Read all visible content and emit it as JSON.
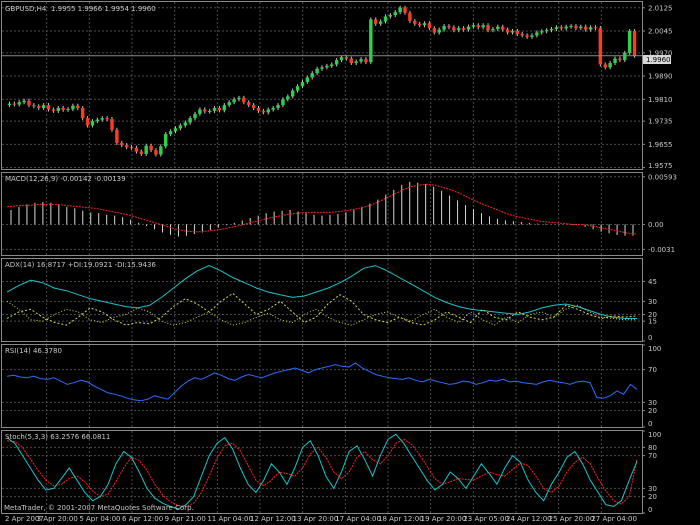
{
  "header": {
    "symbol": "GBPUSD,H4",
    "ohlc": "1.9955 1.9966 1.9954 1.9960",
    "current_price": "1.9960"
  },
  "colors": {
    "background": "#000000",
    "grid": "#4a4a4a",
    "axis_text": "#c8c8c8",
    "bull_candle": "#2fd14a",
    "bear_candle": "#ff3a28",
    "candle_wick": "#c8c8c8",
    "macd_hist": "#d8d8d8",
    "macd_signal": "#ff2020",
    "adx": "#19c3c8",
    "plus_di": "#d9d94a",
    "minus_di": "#d9d94a",
    "rsi": "#2a6dff",
    "stoch_main": "#19c3c8",
    "stoch_signal": "#ff2020"
  },
  "footer": {
    "copyright": "MetaTrader, © 2001-2007 MetaQuotes Software Corp."
  },
  "chart_data": [
    {
      "type": "candlestick",
      "title": "GBPUSD,H4",
      "yticks": [
        "2.0125",
        "2.0045",
        "1.9970",
        "1.9890",
        "1.9810",
        "1.9735",
        "1.9655",
        "1.9575"
      ],
      "ylim": [
        1.957,
        2.0145
      ],
      "close": [
        1.9795,
        1.9792,
        1.98,
        1.9805,
        1.979,
        1.9786,
        1.978,
        1.979,
        1.9775,
        1.977,
        1.978,
        1.9774,
        1.9776,
        1.9788,
        1.978,
        1.9745,
        1.972,
        1.9735,
        1.974,
        1.9745,
        1.9742,
        1.9705,
        1.966,
        1.9652,
        1.9645,
        1.9643,
        1.963,
        1.9622,
        1.965,
        1.9635,
        1.962,
        1.9648,
        1.969,
        1.97,
        1.971,
        1.972,
        1.973,
        1.9745,
        1.976,
        1.9775,
        1.9768,
        1.977,
        1.978,
        1.9772,
        1.979,
        1.98,
        1.981,
        1.9815,
        1.98,
        1.979,
        1.978,
        1.977,
        1.9765,
        1.9775,
        1.978,
        1.979,
        1.981,
        1.982,
        1.984,
        1.9855,
        1.987,
        1.9885,
        1.99,
        1.9915,
        1.992,
        1.9925,
        1.993,
        1.9945,
        1.9955,
        1.995,
        1.9935,
        1.994,
        1.9948,
        1.9938,
        2.0085,
        2.007,
        2.0078,
        2.0095,
        2.01,
        2.011,
        2.0125,
        2.0108,
        2.008,
        2.007,
        2.0065,
        2.0072,
        2.0055,
        2.004,
        2.005,
        2.0062,
        2.0058,
        2.0048,
        2.0055,
        2.005,
        2.006,
        2.0065,
        2.0058,
        2.0065,
        2.0048,
        2.0052,
        2.006,
        2.005,
        2.004,
        2.0045,
        2.0035,
        2.003,
        2.0025,
        2.003,
        2.004,
        2.0044,
        2.0048,
        2.0052,
        2.0058,
        2.0054,
        2.006,
        2.0062,
        2.0055,
        2.006,
        2.005,
        2.0058,
        2.0055,
        1.993,
        1.992,
        1.9935,
        1.995,
        1.9945,
        1.997,
        2.0045,
        1.996
      ],
      "x_labels": [
        "2 Apr 2007",
        "3 Apr 20:00",
        "5 Apr 04:00",
        "6 Apr 12:00",
        "9 Apr 21:00",
        "11 Apr 04:00",
        "12 Apr 12:00",
        "13 Apr 20:00",
        "17 Apr 04:00",
        "18 Apr 12:00",
        "19 Apr 20:00",
        "23 Apr 05:00",
        "24 Apr 12:00",
        "25 Apr 20:00",
        "27 Apr 04:00"
      ]
    },
    {
      "type": "bar",
      "title": "MACD(12,26,9) -0.00142 -0.00139",
      "yticks": [
        "0.00593",
        "0.00",
        "-0.0031"
      ],
      "ylim": [
        -0.0038,
        0.0064
      ],
      "series": [
        {
          "name": "MACD",
          "values": [
            0.0018,
            0.0022,
            0.0025,
            0.0027,
            0.0028,
            0.0027,
            0.0025,
            0.0022,
            0.002,
            0.0017,
            0.0015,
            0.0014,
            0.0012,
            0.0011,
            0.0009,
            0.0006,
            0.0002,
            -0.0002,
            -0.0006,
            -0.001,
            -0.0013,
            -0.0015,
            -0.0014,
            -0.0012,
            -0.001,
            -0.0007,
            -0.0004,
            -0.0001,
            0.0002,
            0.0005,
            0.0008,
            0.0011,
            0.0014,
            0.0016,
            0.0017,
            0.0018,
            0.0016,
            0.0014,
            0.0012,
            0.0011,
            0.0012,
            0.0013,
            0.0015,
            0.0018,
            0.0022,
            0.0026,
            0.0031,
            0.0037,
            0.0043,
            0.0049,
            0.0053,
            0.0052,
            0.005,
            0.0047,
            0.0042,
            0.0036,
            0.003,
            0.0024,
            0.0019,
            0.0014,
            0.001,
            0.0007,
            0.0005,
            0.0004,
            0.0003,
            0.0002,
            0.0001,
            0.0001,
            0.0,
            0.0,
            0.0001,
            0.0,
            -0.0003,
            -0.0006,
            -0.0009,
            -0.0011,
            -0.0013,
            -0.0014,
            -0.0014
          ]
        },
        {
          "name": "Signal",
          "values": [
            0.0022,
            0.0023,
            0.0024,
            0.0024,
            0.0025,
            0.0025,
            0.0025,
            0.0024,
            0.0023,
            0.0022,
            0.0021,
            0.002,
            0.0018,
            0.0016,
            0.0014,
            0.0012,
            0.0009,
            0.0006,
            0.0003,
            0.0,
            -0.0003,
            -0.0006,
            -0.0008,
            -0.0009,
            -0.0009,
            -0.0008,
            -0.0007,
            -0.0005,
            -0.0003,
            -0.0001,
            0.0002,
            0.0004,
            0.0007,
            0.0009,
            0.0011,
            0.0013,
            0.0014,
            0.0015,
            0.0015,
            0.0015,
            0.0015,
            0.0016,
            0.0017,
            0.0019,
            0.0021,
            0.0024,
            0.0028,
            0.0033,
            0.0038,
            0.0043,
            0.0047,
            0.0049,
            0.005,
            0.0049,
            0.0046,
            0.0043,
            0.0039,
            0.0034,
            0.0029,
            0.0025,
            0.0021,
            0.0017,
            0.0013,
            0.001,
            0.0008,
            0.0006,
            0.0004,
            0.0003,
            0.0002,
            0.0001,
            0.0,
            0.0,
            -0.0001,
            -0.0003,
            -0.0005,
            -0.0007,
            -0.0009,
            -0.0011,
            -0.0012
          ]
        }
      ]
    },
    {
      "type": "line",
      "title": "ADX(14) 16.8717 +DI:19.0921 -DI:15.9436",
      "yticks": [
        "45",
        "30",
        "20",
        "15",
        "0"
      ],
      "ylim": [
        0,
        62
      ],
      "series": [
        {
          "name": "ADX",
          "values": [
            37,
            42,
            46,
            44,
            40,
            38,
            35,
            32,
            30,
            28,
            26,
            25,
            27,
            33,
            40,
            47,
            53,
            57,
            53,
            48,
            44,
            40,
            37,
            35,
            33,
            34,
            37,
            40,
            44,
            49,
            55,
            57,
            53,
            48,
            43,
            38,
            33,
            29,
            26,
            24,
            23,
            22,
            21,
            20,
            22,
            25,
            27,
            28,
            26,
            23,
            20,
            18,
            17,
            17
          ]
        },
        {
          "name": "+DI",
          "values": [
            17,
            22,
            24,
            18,
            14,
            12,
            18,
            25,
            22,
            16,
            12,
            14,
            13,
            18,
            26,
            32,
            28,
            22,
            30,
            36,
            28,
            20,
            24,
            30,
            22,
            14,
            18,
            28,
            35,
            30,
            20,
            16,
            14,
            18,
            14,
            12,
            16,
            22,
            18,
            14,
            24,
            18,
            16,
            22,
            18,
            16,
            18,
            27,
            24,
            20,
            17,
            19,
            18,
            19
          ]
        },
        {
          "name": "-DI",
          "values": [
            30,
            24,
            16,
            15,
            20,
            24,
            22,
            16,
            14,
            18,
            20,
            25,
            22,
            15,
            12,
            14,
            18,
            22,
            16,
            12,
            14,
            18,
            21,
            16,
            14,
            20,
            24,
            18,
            14,
            12,
            16,
            20,
            22,
            18,
            15,
            20,
            24,
            18,
            14,
            22,
            16,
            12,
            18,
            14,
            20,
            22,
            18,
            24,
            27,
            22,
            18,
            17,
            16,
            16
          ]
        }
      ]
    },
    {
      "type": "line",
      "title": "RSI(14) 46.3780",
      "yticks": [
        "100",
        "70",
        "30",
        "20",
        "0"
      ],
      "ylim": [
        0,
        100
      ],
      "series": [
        {
          "name": "RSI",
          "values": [
            62,
            63,
            61,
            60,
            62,
            59,
            58,
            60,
            56,
            52,
            54,
            57,
            55,
            50,
            46,
            42,
            40,
            38,
            35,
            33,
            32,
            34,
            38,
            36,
            34,
            42,
            50,
            56,
            60,
            58,
            62,
            66,
            63,
            59,
            57,
            61,
            64,
            62,
            60,
            63,
            66,
            68,
            70,
            72,
            69,
            66,
            70,
            72,
            74,
            76,
            74,
            73,
            78,
            72,
            68,
            64,
            62,
            60,
            59,
            58,
            60,
            57,
            55,
            58,
            56,
            54,
            52,
            53,
            56,
            55,
            52,
            54,
            57,
            56,
            58,
            55,
            56,
            54,
            53,
            52,
            55,
            57,
            55,
            54,
            52,
            55,
            56,
            54,
            36,
            35,
            38,
            44,
            40,
            52,
            46
          ]
        }
      ]
    },
    {
      "type": "line",
      "title": "Stoch(5,3,3) 63.2576 66.0811",
      "yticks": [
        "100",
        "80",
        "70",
        "30",
        "20",
        "0"
      ],
      "ylim": [
        0,
        100
      ],
      "series": [
        {
          "name": "Main",
          "values": [
            92,
            85,
            70,
            55,
            40,
            28,
            30,
            42,
            55,
            40,
            25,
            15,
            20,
            35,
            60,
            75,
            68,
            50,
            30,
            18,
            12,
            8,
            5,
            10,
            20,
            45,
            70,
            85,
            92,
            78,
            55,
            35,
            25,
            40,
            60,
            50,
            35,
            55,
            80,
            88,
            70,
            45,
            30,
            50,
            75,
            82,
            65,
            45,
            70,
            90,
            96,
            85,
            70,
            55,
            40,
            28,
            35,
            50,
            42,
            30,
            45,
            60,
            48,
            35,
            55,
            70,
            62,
            40,
            25,
            15,
            35,
            50,
            68,
            75,
            60,
            40,
            25,
            10,
            8,
            15,
            40,
            63
          ]
        },
        {
          "name": "Signal",
          "values": [
            88,
            87,
            80,
            66,
            52,
            40,
            33,
            35,
            42,
            45,
            38,
            27,
            20,
            23,
            38,
            55,
            68,
            64,
            52,
            35,
            22,
            14,
            9,
            8,
            12,
            25,
            45,
            67,
            82,
            85,
            76,
            58,
            40,
            33,
            40,
            50,
            48,
            45,
            55,
            72,
            80,
            68,
            50,
            42,
            50,
            68,
            75,
            65,
            60,
            70,
            85,
            90,
            84,
            72,
            57,
            42,
            35,
            38,
            42,
            41,
            40,
            45,
            50,
            47,
            45,
            53,
            61,
            58,
            45,
            30,
            25,
            33,
            50,
            62,
            68,
            60,
            42,
            27,
            15,
            11,
            20,
            66
          ]
        }
      ]
    }
  ]
}
